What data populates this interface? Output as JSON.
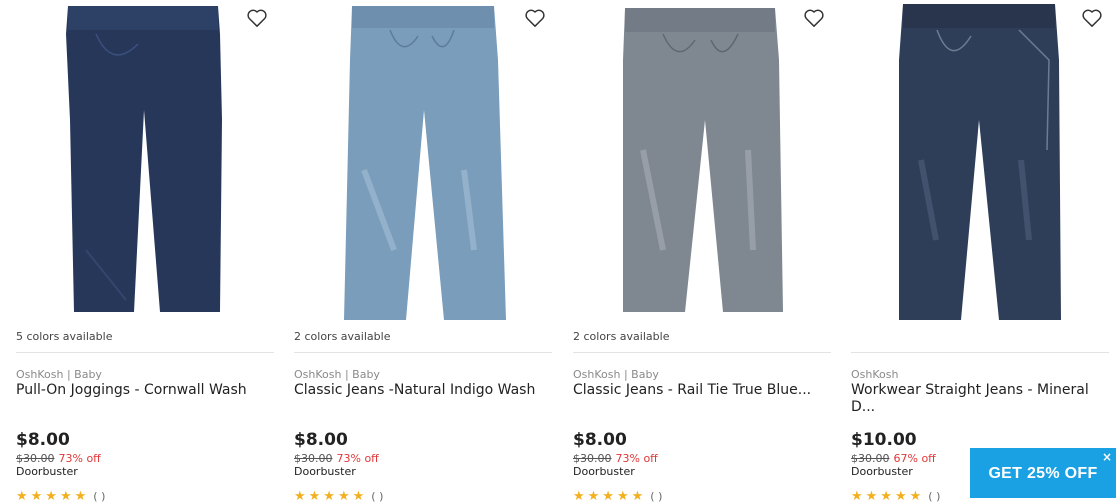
{
  "products": [
    {
      "colors_text": "5 colors available",
      "brand": "OshKosh | Baby",
      "name": "Pull-On Joggings - Cornwall Wash",
      "price": "$8.00",
      "was_price": "$30.00",
      "discount": "73% off",
      "badge": "Doorbuster",
      "rating_stars": "★★★★★",
      "review_count": "( )",
      "image_icon": "jeans-dark-rinse",
      "denim_color": "#27375a"
    },
    {
      "colors_text": "2 colors available",
      "brand": "OshKosh | Baby",
      "name": "Classic Jeans -Natural Indigo Wash",
      "price": "$8.00",
      "was_price": "$30.00",
      "discount": "73% off",
      "badge": "Doorbuster",
      "rating_stars": "★★★★★",
      "review_count": "( )",
      "image_icon": "jeans-light-wash",
      "denim_color": "#7a9dbb"
    },
    {
      "colors_text": "2 colors available",
      "brand": "OshKosh | Baby",
      "name": "Classic Jeans - Rail Tie True Blue...",
      "price": "$8.00",
      "was_price": "$30.00",
      "discount": "73% off",
      "badge": "Doorbuster",
      "rating_stars": "★★★★★",
      "review_count": "( )",
      "image_icon": "jeans-grey-wash",
      "denim_color": "#7f8891"
    },
    {
      "colors_text": "",
      "brand": "OshKosh",
      "name": "Workwear Straight Jeans - Mineral D...",
      "price": "$10.00",
      "was_price": "$30.00",
      "discount": "67% off",
      "badge": "Doorbuster",
      "rating_stars": "★★★★★",
      "review_count": "( )",
      "image_icon": "jeans-workwear-dark",
      "denim_color": "#2f3e58"
    }
  ],
  "promo": {
    "label": "GET 25% OFF",
    "close_icon": "×",
    "color": "#1aa1e3"
  },
  "icons": {
    "favorite": "heart-outline-icon"
  }
}
